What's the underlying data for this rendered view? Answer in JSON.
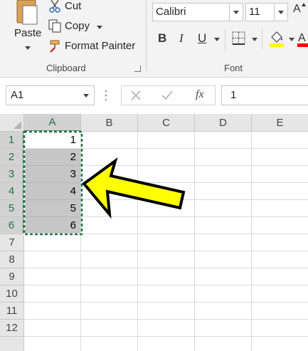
{
  "clipboard": {
    "paste_label": "Paste",
    "cut_label": "Cut",
    "copy_label": "Copy",
    "format_painter_label": "Format Painter",
    "group_label": "Clipboard"
  },
  "font": {
    "font_name": "Calibri",
    "font_size": "11",
    "bold_label": "B",
    "italic_label": "I",
    "underline_label": "U",
    "grow_label": "A",
    "group_label": "Font",
    "fill_color": "#ffff00",
    "font_color": "#ff0000"
  },
  "formula_bar": {
    "name_box": "A1",
    "fx_label": "fx",
    "value": "1"
  },
  "grid": {
    "columns": [
      "A",
      "B",
      "C",
      "D",
      "E"
    ],
    "rows": [
      "1",
      "2",
      "3",
      "4",
      "5",
      "6",
      "7",
      "8",
      "9",
      "10",
      "11",
      "12"
    ],
    "column_a_values": [
      "1",
      "2",
      "3",
      "4",
      "5",
      "6"
    ]
  },
  "annotation": {
    "arrow_color": "#ffff00"
  },
  "colors": {
    "accent": "#217346",
    "selection_fill": "#c6c6c6"
  }
}
